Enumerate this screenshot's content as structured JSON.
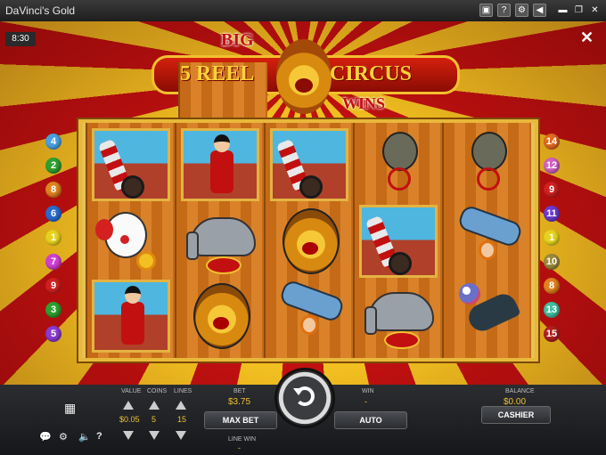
{
  "window": {
    "title": "DaVinci's Gold",
    "controls": [
      "cashier-icon",
      "help-icon",
      "settings-icon",
      "sound-icon",
      "minimize-icon",
      "restore-icon",
      "close-icon"
    ]
  },
  "game": {
    "clock": "8:30",
    "logo": {
      "big": "BIG",
      "reel": "5 REEL",
      "circus": "CIRCUS",
      "wins": "WINS"
    },
    "reels": [
      [
        "cannon",
        "clown",
        "ringmaster"
      ],
      [
        "ringmaster",
        "elephant",
        "lion"
      ],
      [
        "cannon",
        "lion",
        "acrobat"
      ],
      [
        "bear-unicycle",
        "cannon",
        "elephant"
      ],
      [
        "bear-unicycle",
        "acrobat",
        "seal"
      ]
    ],
    "paylines_left": [
      {
        "n": "4",
        "color": "#4aa0e0"
      },
      {
        "n": "2",
        "color": "#2ea02e"
      },
      {
        "n": "8",
        "color": "#e0821e"
      },
      {
        "n": "6",
        "color": "#2a6ad0"
      },
      {
        "n": "1",
        "color": "#e6d21e"
      },
      {
        "n": "7",
        "color": "#d040d0"
      },
      {
        "n": "9",
        "color": "#d02020"
      },
      {
        "n": "3",
        "color": "#2ea02e"
      },
      {
        "n": "5",
        "color": "#8a3ad0"
      }
    ],
    "paylines_right": [
      {
        "n": "14",
        "color": "#e06a1e"
      },
      {
        "n": "12",
        "color": "#d060c0"
      },
      {
        "n": "9",
        "color": "#d02020"
      },
      {
        "n": "11",
        "color": "#6a3ad0"
      },
      {
        "n": "1",
        "color": "#e6d21e"
      },
      {
        "n": "10",
        "color": "#9a8a3a"
      },
      {
        "n": "8",
        "color": "#e0821e"
      },
      {
        "n": "13",
        "color": "#40c0a0"
      },
      {
        "n": "15",
        "color": "#b02020"
      }
    ]
  },
  "controls": {
    "value_label": "VALUE",
    "value": "$0.05",
    "coins_label": "COINS",
    "coins": "5",
    "lines_label": "LINES",
    "lines": "15",
    "bet_label": "BET",
    "bet": "$3.75",
    "win_label": "WIN",
    "win": "-",
    "line_win_label": "LINE WIN",
    "line_win": "-",
    "max_bet": "MAX BET",
    "auto": "AUTO",
    "balance_label": "BALANCE",
    "balance": "$0.00",
    "cashier": "CASHIER"
  }
}
